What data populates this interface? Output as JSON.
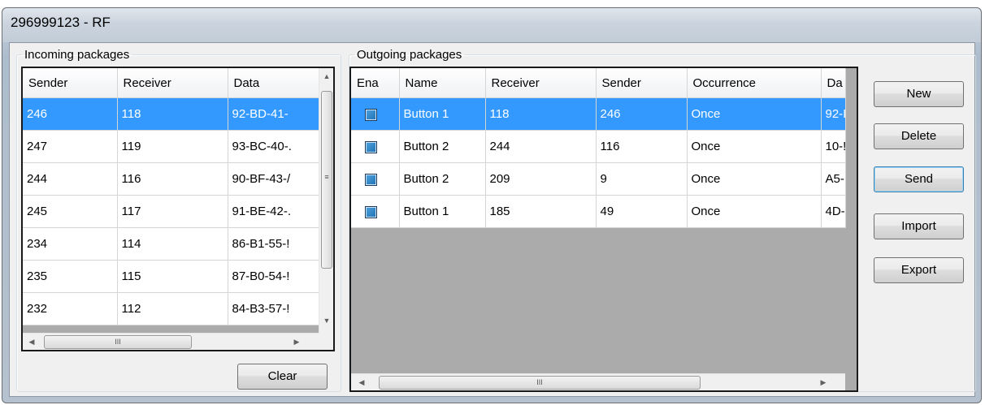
{
  "window": {
    "title": "296999123 - RF"
  },
  "incoming": {
    "group_label": "Incoming packages",
    "columns": [
      "Sender",
      "Receiver",
      "Data"
    ],
    "rows": [
      {
        "sender": "246",
        "receiver": "118",
        "data": "92-BD-41-",
        "selected": true
      },
      {
        "sender": "247",
        "receiver": "119",
        "data": "93-BC-40-.",
        "selected": false
      },
      {
        "sender": "244",
        "receiver": "116",
        "data": "90-BF-43-/",
        "selected": false
      },
      {
        "sender": "245",
        "receiver": "117",
        "data": "91-BE-42-.",
        "selected": false
      },
      {
        "sender": "234",
        "receiver": "114",
        "data": "86-B1-55-!",
        "selected": false
      },
      {
        "sender": "235",
        "receiver": "115",
        "data": "87-B0-54-!",
        "selected": false
      },
      {
        "sender": "232",
        "receiver": "112",
        "data": "84-B3-57-!",
        "selected": false
      }
    ],
    "clear_label": "Clear"
  },
  "outgoing": {
    "group_label": "Outgoing packages",
    "columns": [
      "Ena",
      "Name",
      "Receiver",
      "Sender",
      "Occurrence",
      "Da"
    ],
    "rows": [
      {
        "enabled": true,
        "name": "Button 1",
        "receiver": "118",
        "sender": "246",
        "occurrence": "Once",
        "data": "92-I",
        "selected": true
      },
      {
        "enabled": true,
        "name": "Button 2",
        "receiver": "244",
        "sender": "116",
        "occurrence": "Once",
        "data": "10-!",
        "selected": false
      },
      {
        "enabled": true,
        "name": "Button 2",
        "receiver": "209",
        "sender": "9",
        "occurrence": "Once",
        "data": "A5-",
        "selected": false
      },
      {
        "enabled": true,
        "name": "Button 1",
        "receiver": "185",
        "sender": "49",
        "occurrence": "Once",
        "data": "4D-",
        "selected": false
      }
    ]
  },
  "buttons": {
    "new": "New",
    "delete": "Delete",
    "send": "Send",
    "import": "Import",
    "export": "Export"
  },
  "scrollbar": {
    "grip": "III"
  },
  "colors": {
    "selection": "#3399ff",
    "checkbox": "#2a7fc6"
  }
}
